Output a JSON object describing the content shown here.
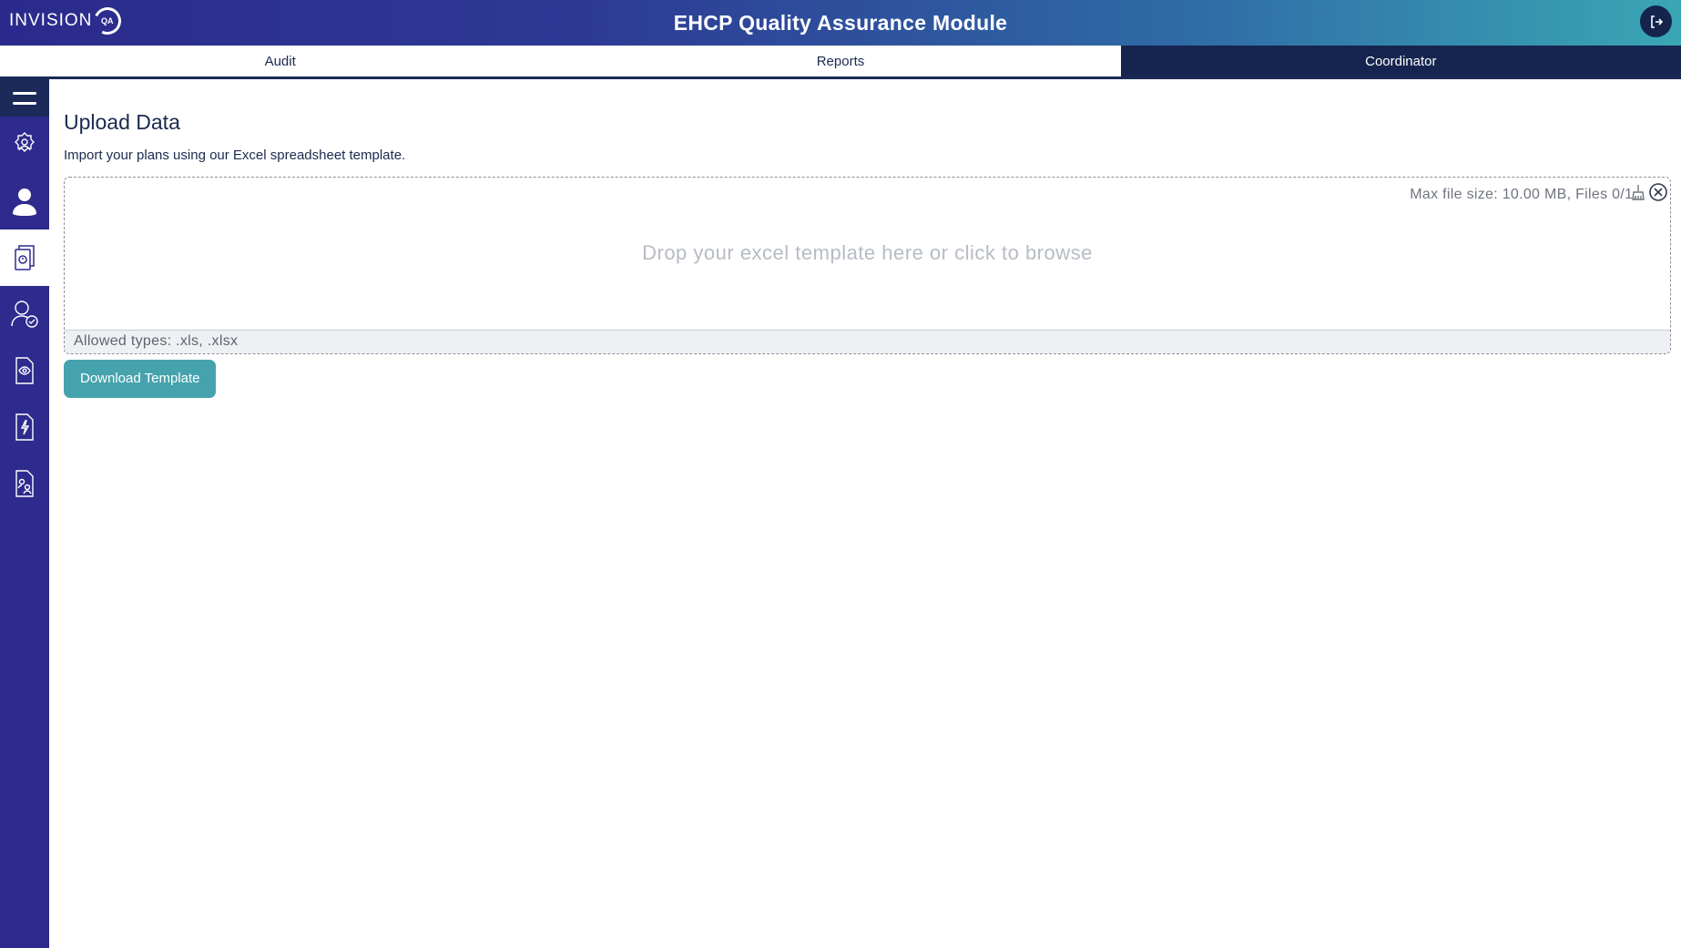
{
  "header": {
    "logo_text": "INVISION",
    "logo_badge": "QA",
    "title": "EHCP Quality Assurance Module",
    "logout_icon": "logout-icon"
  },
  "tabs": [
    {
      "label": "Audit",
      "active": false
    },
    {
      "label": "Reports",
      "active": false
    },
    {
      "label": "Coordinator",
      "active": true
    }
  ],
  "sidebar": {
    "items": [
      {
        "icon": "menu-icon"
      },
      {
        "icon": "settings-users-icon"
      },
      {
        "icon": "user-icon"
      },
      {
        "icon": "document-stack-icon",
        "selected": true
      },
      {
        "icon": "user-check-icon"
      },
      {
        "icon": "document-eye-icon"
      },
      {
        "icon": "document-bolt-icon"
      },
      {
        "icon": "document-people-icon"
      }
    ]
  },
  "main": {
    "title": "Upload Data",
    "subtitle": "Import your plans using our Excel spreadsheet template.",
    "dropzone": {
      "info": "Max file size: 10.00 MB, Files 0/1,",
      "drop_text": "Drop your excel template here or click to browse",
      "allowed": "Allowed types: .xls, .xlsx"
    },
    "download_label": "Download Template"
  },
  "colors": {
    "header_start": "#2b2a8c",
    "header_end": "#3aa6b4",
    "sidebar": "#2e2a8e",
    "active_tab": "#15254f",
    "button": "#46a3ad"
  }
}
